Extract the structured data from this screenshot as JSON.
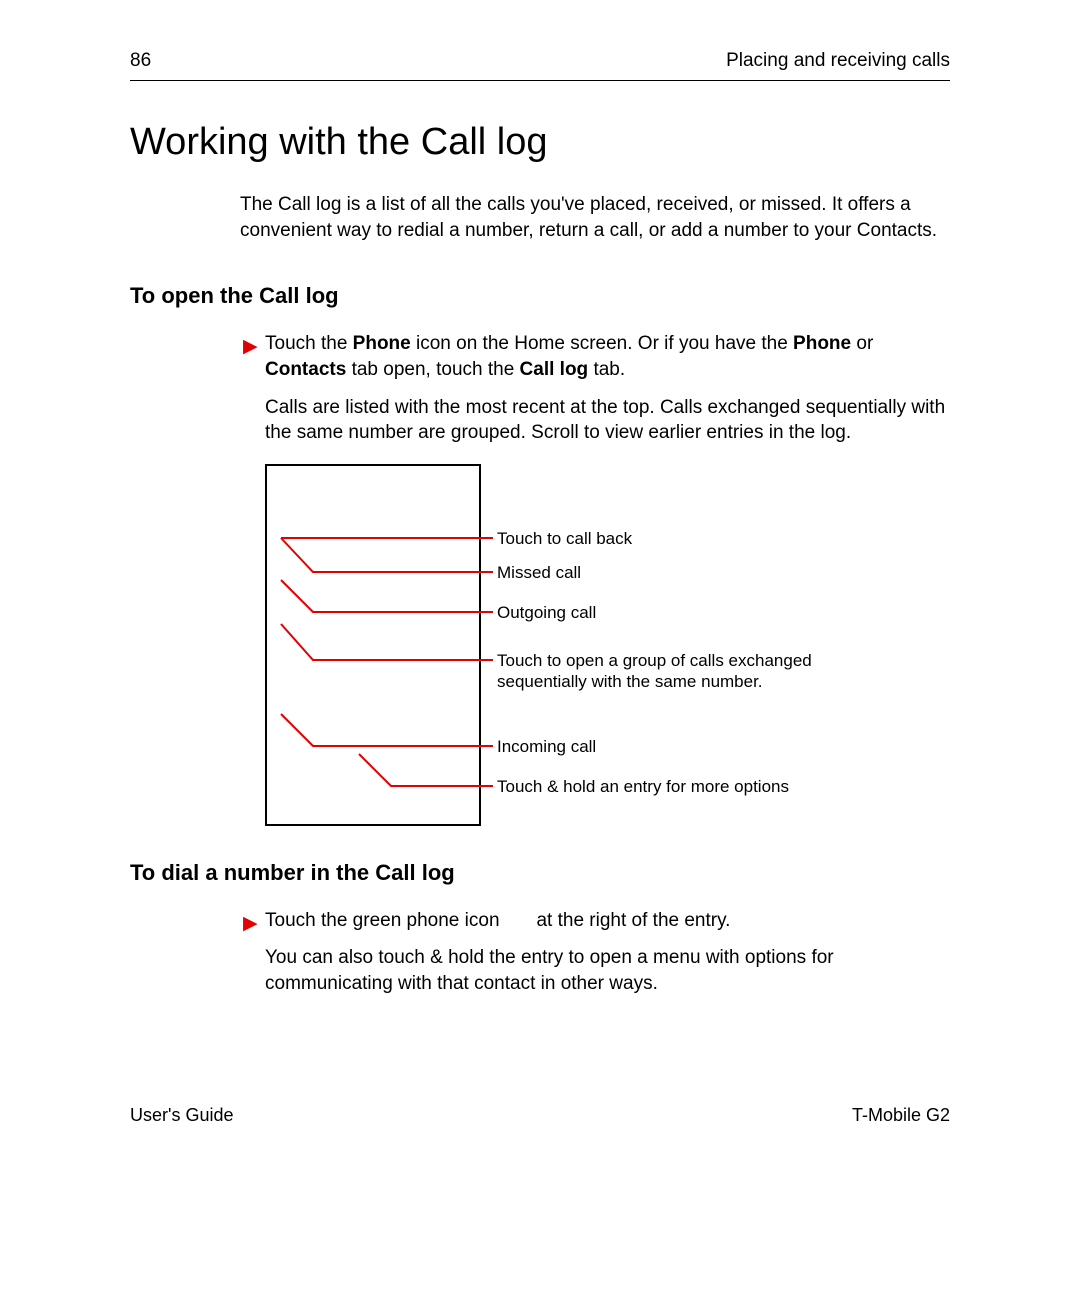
{
  "header": {
    "page_number": "86",
    "section": "Placing and receiving calls"
  },
  "title": "Working with the Call log",
  "intro": "The Call log is a list of all the calls you've placed, received, or missed. It offers a convenient way to redial a number, return a call, or add a number to your Contacts.",
  "section1": {
    "heading": "To open the Call log",
    "bullet_pre": "Touch the ",
    "bullet_b1": "Phone",
    "bullet_mid1": " icon on the Home screen. Or if you have the ",
    "bullet_b2": "Phone",
    "bullet_mid2": "  or ",
    "bullet_b3": "Contacts",
    "bullet_mid3": "  tab open, touch the ",
    "bullet_b4": "Call log",
    "bullet_post": "  tab.",
    "para": "Calls are listed with the most recent at the top. Calls exchanged sequentially with the same number are grouped. Scroll to view earlier entries in the log."
  },
  "callouts": {
    "c1": "Touch to call back",
    "c2": "Missed call",
    "c3": "Outgoing call",
    "c4": "Touch to open a group of calls exchanged sequentially with the same number.",
    "c5": "Incoming call",
    "c6": "Touch & hold an entry for more options"
  },
  "section2": {
    "heading": "To dial a number in the Call log",
    "bullet_pre": "Touch the green phone icon ",
    "bullet_post": "      at the right of the entry.",
    "para": "You can also touch & hold the entry to open a menu with options for communicating with that contact in other ways."
  },
  "footer": {
    "left": "User's Guide",
    "right": "T-Mobile G2"
  },
  "colors": {
    "accent": "#e20000"
  }
}
